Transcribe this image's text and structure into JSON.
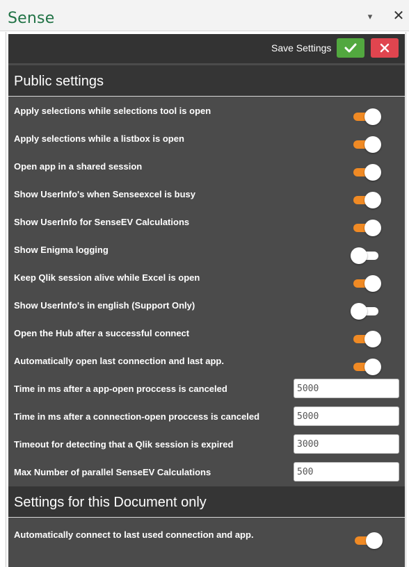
{
  "pane": {
    "title": "Sense",
    "dropdown_icon": "chevron-down-icon",
    "close_icon": "close-icon",
    "title_color": "#217346"
  },
  "toolbar": {
    "save_label": "Save Settings",
    "ok_color": "#52a83f",
    "cancel_color": "#e0454f"
  },
  "colors": {
    "panel_bg": "#4b4b4b",
    "header_bg": "#353535",
    "toggle_on": "#f08a24"
  },
  "public_settings": {
    "title": "Public settings",
    "toggles": [
      {
        "label": "Apply selections while selections tool is open",
        "on": true
      },
      {
        "label": "Apply selections while a listbox is open",
        "on": true
      },
      {
        "label": "Open app in a shared session",
        "on": true
      },
      {
        "label": "Show UserInfo's when Senseexcel is busy",
        "on": true
      },
      {
        "label": "Show UserInfo for SenseEV Calculations",
        "on": true
      },
      {
        "label": "Show Enigma logging",
        "on": false
      },
      {
        "label": "Keep Qlik session alive while Excel is open",
        "on": true
      },
      {
        "label": "Show UserInfo's in english (Support Only)",
        "on": false
      },
      {
        "label": "Open the Hub after a successful connect",
        "on": true
      },
      {
        "label": "Automatically open last connection and last app.",
        "on": true
      }
    ],
    "inputs": [
      {
        "label": "Time in ms after a app-open proccess is canceled",
        "value": "5000"
      },
      {
        "label": "Time in ms after a connection-open proccess is canceled",
        "value": "5000"
      },
      {
        "label": "Timeout for detecting that a Qlik session is expired",
        "value": "3000"
      },
      {
        "label": "Max Number of parallel SenseEV Calculations",
        "value": "500"
      }
    ]
  },
  "document_settings": {
    "title": "Settings for this Document only",
    "toggles": [
      {
        "label": "Automatically connect to last used connection and app.",
        "on": true
      }
    ]
  }
}
